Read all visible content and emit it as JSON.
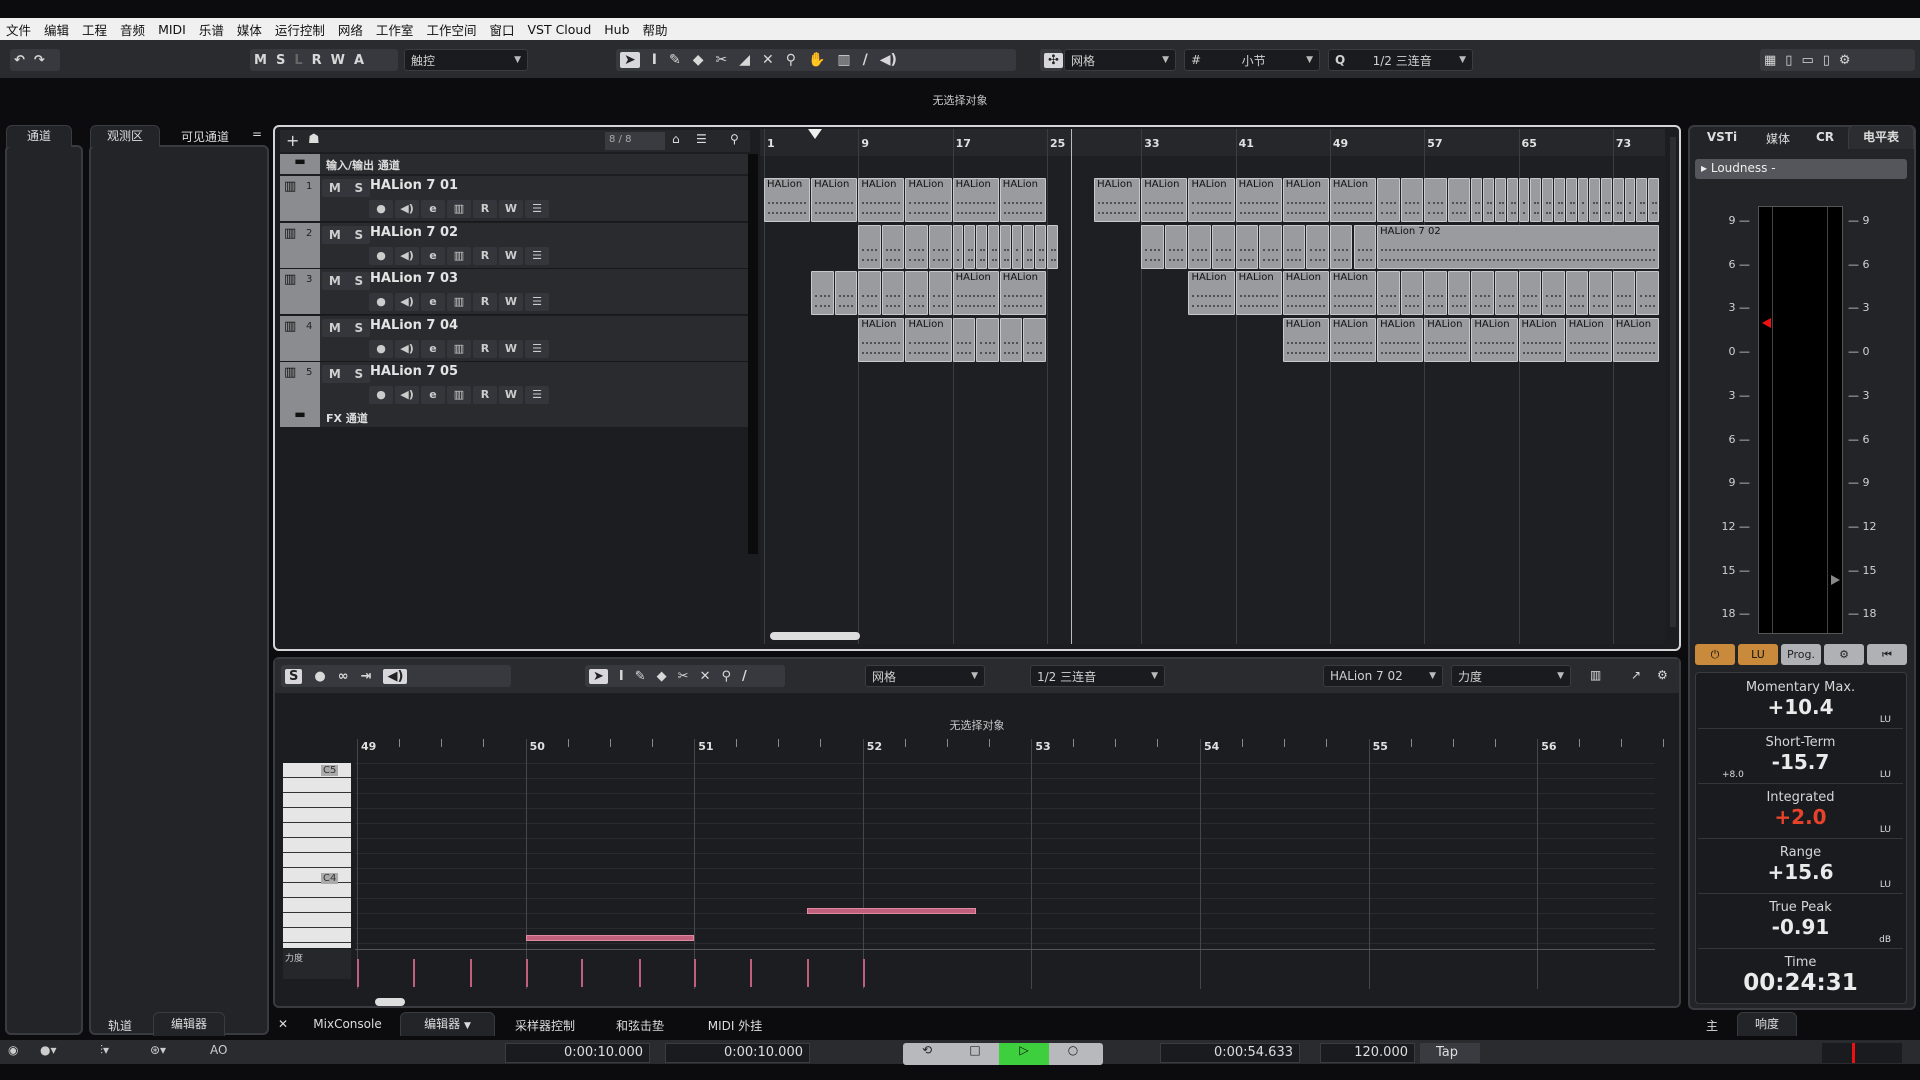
{
  "menu": [
    "文件",
    "编辑",
    "工程",
    "音频",
    "MIDI",
    "乐谱",
    "媒体",
    "运行控制",
    "网络",
    "工作室",
    "工作空间",
    "窗口",
    "VST Cloud",
    "Hub",
    "帮助"
  ],
  "toolbar": {
    "msrwa": [
      "M",
      "S",
      "L",
      "R",
      "W",
      "A"
    ],
    "automation_mode": "触控",
    "snap_type": "网格",
    "grid_type": "小节",
    "quantize": "1/2 三连音"
  },
  "info_line": "无选择对象",
  "left_zone": {
    "tab": "通道"
  },
  "inspector_tabs": [
    "观测区",
    "可见通道"
  ],
  "project": {
    "track_count": "8 / 8",
    "io_folder": "输入/输出 通道",
    "fx_folder": "FX 通道",
    "tracks": [
      {
        "num": "1",
        "name": "HALion 7 01"
      },
      {
        "num": "2",
        "name": "HALion 7 02"
      },
      {
        "num": "3",
        "name": "HALion 7 03"
      },
      {
        "num": "4",
        "name": "HALion 7 04"
      },
      {
        "num": "5",
        "name": "HALion 7 05"
      }
    ],
    "track_buttons": {
      "mute": "M",
      "solo": "S",
      "read": "R",
      "write": "W"
    },
    "ruler": [
      "1",
      "9",
      "17",
      "25",
      "33",
      "41",
      "49",
      "57",
      "65",
      "73"
    ],
    "clips": [
      [
        [
          1,
          4,
          "HALion"
        ],
        [
          5,
          4,
          "HALion"
        ],
        [
          9,
          4,
          "HALion"
        ],
        [
          13,
          4,
          "HALion"
        ],
        [
          17,
          4,
          "HALion"
        ],
        [
          21,
          4,
          "HALion"
        ],
        [
          29,
          4,
          "HALion"
        ],
        [
          33,
          4,
          "HALion"
        ],
        [
          37,
          4,
          "HALion"
        ],
        [
          41,
          4,
          "HALion"
        ],
        [
          45,
          4,
          "HALion"
        ],
        [
          49,
          4,
          "HALion"
        ],
        [
          53,
          2,
          ""
        ],
        [
          55,
          2,
          ""
        ],
        [
          57,
          2,
          ""
        ],
        [
          59,
          2,
          ""
        ],
        [
          61,
          1,
          ""
        ],
        [
          62,
          1,
          ""
        ],
        [
          63,
          1,
          ""
        ],
        [
          64,
          1,
          ""
        ],
        [
          65,
          1,
          ""
        ],
        [
          66,
          1,
          ""
        ],
        [
          67,
          1,
          ""
        ],
        [
          68,
          1,
          ""
        ],
        [
          69,
          1,
          ""
        ],
        [
          70,
          1,
          ""
        ],
        [
          71,
          1,
          ""
        ],
        [
          72,
          1,
          ""
        ],
        [
          73,
          1,
          ""
        ],
        [
          74,
          1,
          ""
        ],
        [
          75,
          1,
          ""
        ],
        [
          76,
          1,
          ""
        ]
      ],
      [
        [
          9,
          2,
          ""
        ],
        [
          11,
          2,
          ""
        ],
        [
          13,
          2,
          ""
        ],
        [
          15,
          2,
          ""
        ],
        [
          17,
          1,
          ""
        ],
        [
          18,
          1,
          ""
        ],
        [
          19,
          1,
          ""
        ],
        [
          20,
          1,
          ""
        ],
        [
          21,
          1,
          ""
        ],
        [
          22,
          1,
          ""
        ],
        [
          23,
          1,
          ""
        ],
        [
          24,
          1,
          ""
        ],
        [
          25,
          1,
          ""
        ],
        [
          33,
          2,
          ""
        ],
        [
          35,
          2,
          ""
        ],
        [
          37,
          2,
          ""
        ],
        [
          39,
          2,
          ""
        ],
        [
          41,
          2,
          ""
        ],
        [
          43,
          2,
          ""
        ],
        [
          45,
          2,
          ""
        ],
        [
          47,
          2,
          ""
        ],
        [
          49,
          2,
          ""
        ],
        [
          51,
          2,
          ""
        ],
        [
          53,
          24,
          "HALion 7 02"
        ]
      ],
      [
        [
          5,
          2,
          ""
        ],
        [
          7,
          2,
          ""
        ],
        [
          9,
          2,
          ""
        ],
        [
          11,
          2,
          ""
        ],
        [
          13,
          2,
          ""
        ],
        [
          15,
          2,
          ""
        ],
        [
          17,
          4,
          "HALion"
        ],
        [
          21,
          4,
          "HALion"
        ],
        [
          37,
          4,
          "HALion"
        ],
        [
          41,
          4,
          "HALion"
        ],
        [
          45,
          4,
          "HALion"
        ],
        [
          49,
          4,
          "HALion"
        ],
        [
          53,
          2,
          ""
        ],
        [
          55,
          2,
          ""
        ],
        [
          57,
          2,
          ""
        ],
        [
          59,
          2,
          ""
        ],
        [
          61,
          2,
          ""
        ],
        [
          63,
          2,
          ""
        ],
        [
          65,
          2,
          ""
        ],
        [
          67,
          2,
          ""
        ],
        [
          69,
          2,
          ""
        ],
        [
          71,
          2,
          ""
        ],
        [
          73,
          2,
          ""
        ],
        [
          75,
          2,
          ""
        ]
      ],
      [
        [
          9,
          4,
          "HALion"
        ],
        [
          13,
          4,
          "HALion"
        ],
        [
          17,
          2,
          ""
        ],
        [
          19,
          2,
          ""
        ],
        [
          21,
          2,
          ""
        ],
        [
          23,
          2,
          ""
        ],
        [
          45,
          4,
          "HALion"
        ],
        [
          49,
          4,
          "HALion"
        ],
        [
          53,
          4,
          "HALion"
        ],
        [
          57,
          4,
          "HALion"
        ],
        [
          61,
          4,
          "HALion"
        ],
        [
          65,
          4,
          "HALion"
        ],
        [
          69,
          4,
          "HALion"
        ],
        [
          73,
          4,
          "HALion"
        ]
      ]
    ]
  },
  "editor": {
    "snap_type": "网格",
    "quantize": "1/2 三连音",
    "part": "HALion 7 02",
    "controller": "力度",
    "info_line": "无选择对象",
    "ruler": [
      "49",
      "50",
      "51",
      "52",
      "53",
      "54",
      "55",
      "56"
    ],
    "keys": {
      "c5": "C5",
      "c4": "C4"
    },
    "velocity_label": "力度",
    "notes": [
      [
        50,
        1,
        "A3"
      ],
      [
        51.67,
        1,
        "B3"
      ]
    ],
    "velocity_positions": [
      49,
      49.33,
      49.67,
      50,
      50.33,
      50.67,
      51,
      51.33,
      51.67,
      52
    ]
  },
  "right_zone": {
    "tabs": [
      "VSTi",
      "媒体",
      "CR",
      "电平表"
    ],
    "loudness_header": "Loudness  -",
    "scale": [
      "9",
      "6",
      "3",
      "0",
      "3",
      "6",
      "9",
      "12",
      "15",
      "18"
    ],
    "buttons": [
      "LU",
      "Prog."
    ],
    "stats": [
      {
        "label": "Momentary Max.",
        "value": "+10.4",
        "unit": "LU"
      },
      {
        "label": "Short-Term",
        "value": "-15.7",
        "unit": "LU",
        "extra": "+8.0"
      },
      {
        "label": "Integrated",
        "value": "+2.0",
        "unit": "LU",
        "color": "#e8432a"
      },
      {
        "label": "Range",
        "value": "+15.6",
        "unit": "LU"
      },
      {
        "label": "True Peak",
        "value": "-0.91",
        "unit": "dB"
      },
      {
        "label": "Time",
        "value": "00:24:31"
      }
    ],
    "bottom_tabs": [
      "主",
      "响度"
    ]
  },
  "bottom_tabs": {
    "left": [
      "轨道",
      "编辑器"
    ],
    "lower": [
      "MixConsole",
      "编辑器",
      "采样器控制",
      "和弦击垫",
      "MIDI 外挂"
    ]
  },
  "transport": {
    "left_locator": "0:00:10.000",
    "right_locator": "0:00:10.000",
    "position": "0:00:54.633",
    "tempo": "120.000",
    "tap": "Tap"
  },
  "colors": {
    "play": "#3ecf3e",
    "accent_orange": "#d08a3a",
    "note": "#c0607c"
  }
}
